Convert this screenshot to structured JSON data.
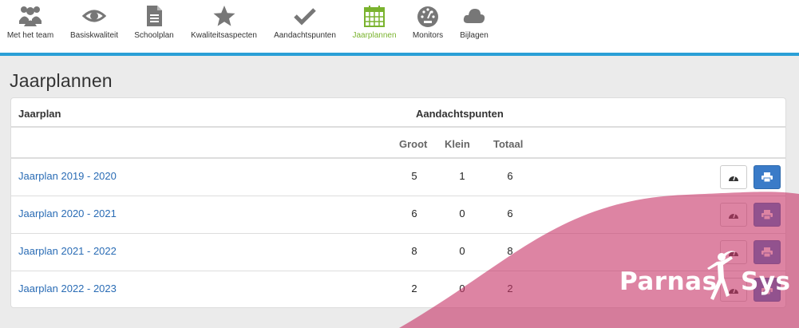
{
  "nav": {
    "items": [
      {
        "label": "Met het team",
        "icon": "team-icon"
      },
      {
        "label": "Basiskwaliteit",
        "icon": "eye-icon"
      },
      {
        "label": "Schoolplan",
        "icon": "document-icon"
      },
      {
        "label": "Kwaliteitsaspecten",
        "icon": "star-icon"
      },
      {
        "label": "Aandachtspunten",
        "icon": "check-icon"
      },
      {
        "label": "Jaarplannen",
        "icon": "calendar-icon",
        "active": true
      },
      {
        "label": "Monitors",
        "icon": "gauge-icon"
      },
      {
        "label": "Bijlagen",
        "icon": "cloud-icon"
      }
    ],
    "active_color": "#7ab32e",
    "accent_color": "#2a9fd6"
  },
  "page": {
    "title": "Jaarplannen"
  },
  "table": {
    "header": {
      "jaarplan": "Jaarplan",
      "aandachtspunten": "Aandachtspunten"
    },
    "subheader": {
      "groot": "Groot",
      "klein": "Klein",
      "totaal": "Totaal"
    },
    "rows": [
      {
        "name": "Jaarplan 2019 - 2020",
        "groot": "5",
        "klein": "1",
        "totaal": "6"
      },
      {
        "name": "Jaarplan 2020 - 2021",
        "groot": "6",
        "klein": "0",
        "totaal": "6"
      },
      {
        "name": "Jaarplan 2021 - 2022",
        "groot": "8",
        "klein": "0",
        "totaal": "8"
      },
      {
        "name": "Jaarplan 2022 - 2023",
        "groot": "2",
        "klein": "0",
        "totaal": "2"
      }
    ]
  },
  "brand": {
    "part1": "Parnas",
    "part2": "Sys",
    "color": "#c8386a"
  }
}
